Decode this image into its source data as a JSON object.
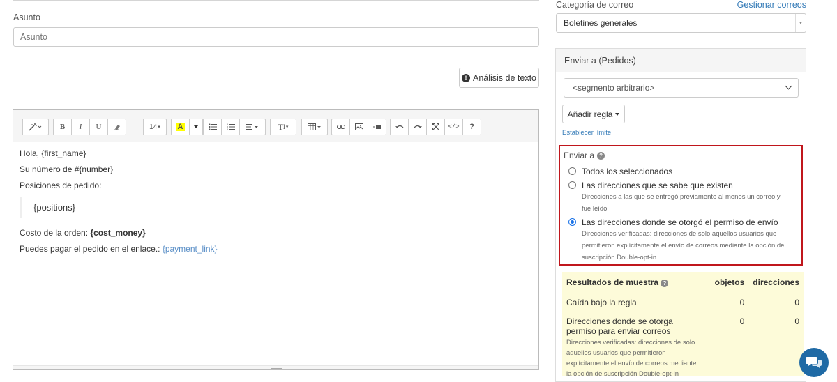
{
  "subject": {
    "label": "Asunto",
    "placeholder": "Asunto"
  },
  "analysis_button": "Análisis de texto",
  "toolbar": {
    "font_size": "14",
    "buttons": [
      "magic-wand",
      "bold",
      "italic",
      "underline",
      "eraser",
      "font-size",
      "highlight",
      "color-dropdown",
      "bullet-list",
      "numbered-list",
      "align",
      "text-style",
      "table",
      "link",
      "image",
      "video",
      "undo",
      "redo",
      "fullscreen",
      "code",
      "help"
    ]
  },
  "editor": {
    "line1": "Hola, {first_name}",
    "line2": "Su número de #{number}",
    "line3": "Posiciones de pedido:",
    "quote": "{positions}",
    "cost_prefix": "Costo de la orden: ",
    "cost_value": "{cost_money}",
    "pay_prefix": "Puedes pagar el pedido en el enlace.: ",
    "pay_link": "{payment_link}"
  },
  "category": {
    "label": "Categoría de correo",
    "manage_link": "Gestionar correos",
    "selected": "Boletines generales"
  },
  "send_panel": {
    "title": "Enviar a (Pedidos)",
    "segment": "<segmento arbitrario>",
    "add_rule": "Añadir regla",
    "set_limit": "Establecer límite"
  },
  "send_to": {
    "title": "Enviar a",
    "options": [
      {
        "label": "Todos los seleccionados",
        "desc": "",
        "checked": false
      },
      {
        "label": "Las direcciones que se sabe que existen",
        "desc": "Direcciones a las que se entregó previamente al menos un correo y fue leído",
        "checked": false
      },
      {
        "label": "Las direcciones donde se otorgó el permiso de envío",
        "desc": "Direcciones verificadas: direcciones de solo aquellos usuarios que permitieron explícitamente el envío de correos mediante la opción de suscripción Double-opt-in",
        "checked": true
      }
    ]
  },
  "results": {
    "title": "Resultados de muestra",
    "col_objects": "objetos",
    "col_addresses": "direcciones",
    "rows": [
      {
        "label": "Caída bajo la regla",
        "desc": "",
        "objects": "0",
        "addresses": "0"
      },
      {
        "label": "Direcciones donde se otorga permiso para enviar correos",
        "desc": "Direcciones verificadas: direcciones de solo aquellos usuarios que permitieron explícitamente el envío de correos mediante la opción de suscripción Double-opt-in",
        "objects": "0",
        "addresses": "0"
      }
    ]
  }
}
